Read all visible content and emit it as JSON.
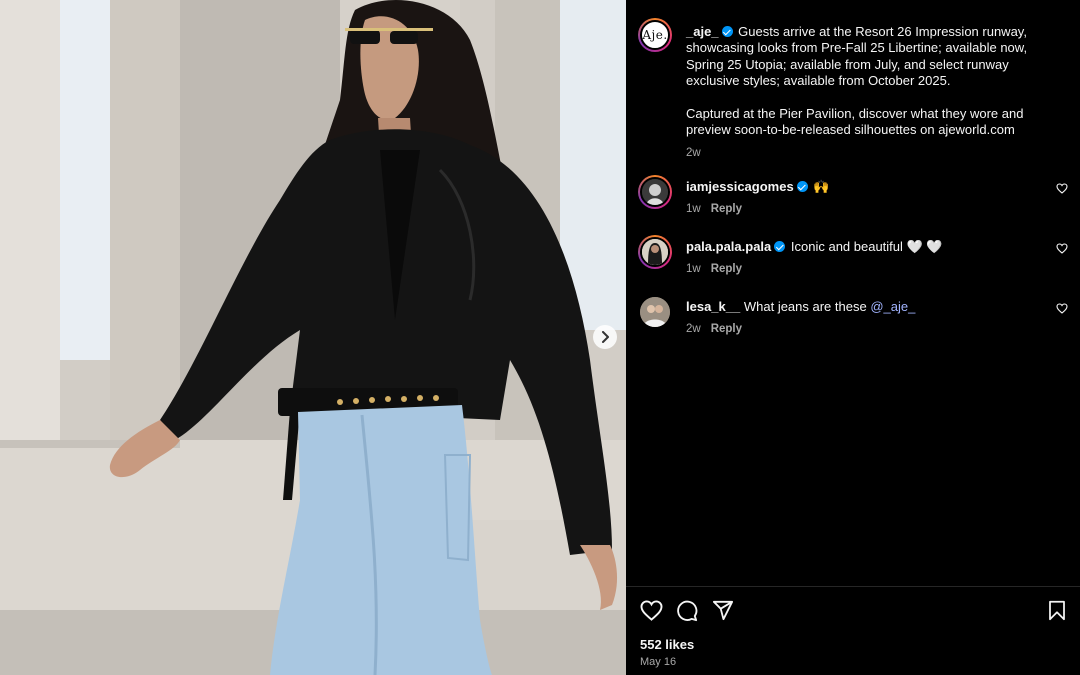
{
  "post": {
    "author": "_aje_",
    "avatar_logo": "Aje.",
    "caption_p1": "Guests arrive at the Resort 26 Impression runway, showcasing looks from Pre-Fall 25 Libertine; available now, Spring 25 Utopia; available from July, and select runway exclusive styles; available from October 2025.",
    "caption_p2": "Captured at the Pier Pavilion, discover what they wore and preview soon-to-be-released silhouettes on ajeworld.com",
    "caption_time": "2w"
  },
  "comments": [
    {
      "username": "iamjessicagomes",
      "verified": true,
      "text": "🙌",
      "time": "1w",
      "reply": "Reply"
    },
    {
      "username": "pala.pala.pala",
      "verified": true,
      "text": "Iconic and beautiful 🤍 🤍",
      "time": "1w",
      "reply": "Reply"
    },
    {
      "username": "lesa_k__",
      "verified": false,
      "text": "What jeans are these",
      "mention": "@_aje_",
      "time": "2w",
      "reply": "Reply"
    }
  ],
  "likes": "552 likes",
  "date": "May 16",
  "icons": {
    "like": "heart-icon",
    "comment": "comment-icon",
    "share": "paper-plane-icon",
    "save": "bookmark-icon",
    "next": "chevron-right-icon"
  },
  "colors": {
    "background": "#000000",
    "verified": "#0095f6",
    "mention": "#a2b4ff",
    "muted": "#a8a8a8"
  }
}
